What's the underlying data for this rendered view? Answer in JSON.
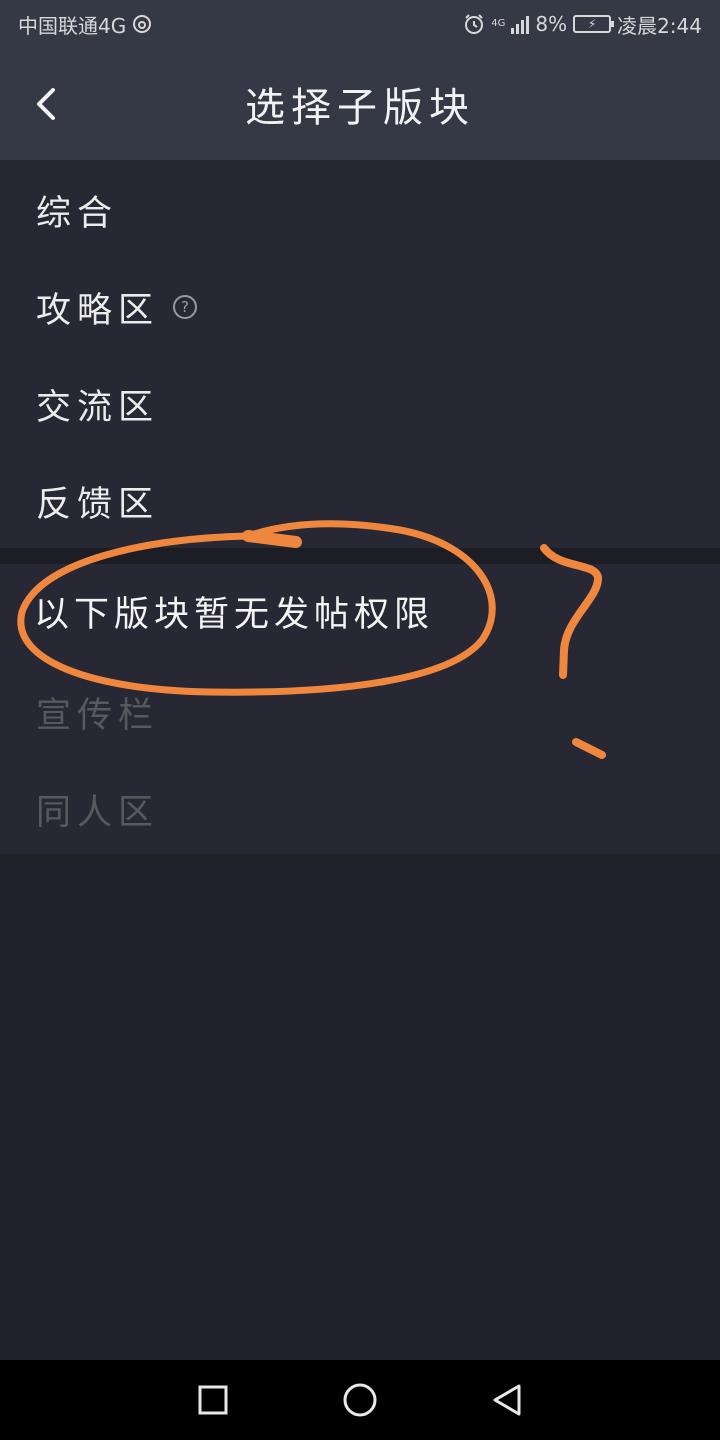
{
  "status_bar": {
    "carrier": "中国联通4G",
    "network": "4G",
    "battery": "8%",
    "time": "凌晨2:44"
  },
  "header": {
    "title": "选择子版块",
    "back_icon": "chevron-left-icon"
  },
  "sections": {
    "available": [
      {
        "label": "综合"
      },
      {
        "label": "攻略区",
        "help_glyph": "?"
      },
      {
        "label": "交流区"
      },
      {
        "label": "反馈区"
      }
    ],
    "notice": "以下版块暂无发帖权限",
    "restricted": [
      {
        "label": "宣传栏"
      },
      {
        "label": "同人区"
      }
    ]
  },
  "annotation": {
    "color": "#f0873e",
    "mark": "?"
  },
  "nav_bar": {
    "icons": [
      "square-recents-icon",
      "circle-home-icon",
      "triangle-back-icon"
    ]
  }
}
